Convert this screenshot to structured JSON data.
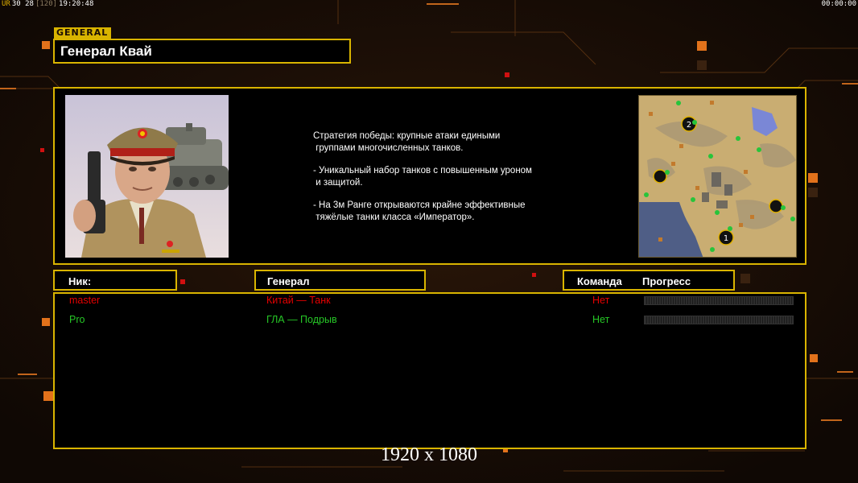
{
  "hud": {
    "left_info_a": "UR",
    "left_info_b": "30 28",
    "left_info_c": "[120]",
    "left_info_d": "19:20:48",
    "right_clock": "00:00:00"
  },
  "general": {
    "tag": "GENERAL",
    "name": "Генерал Квай"
  },
  "description": {
    "paragraphs": [
      "Стратегия победы: крупные атаки едиными\n группами многочисленных танков.",
      "- Уникальный набор танков с повышенным уроном\n и защитой.",
      "- На 3м Ранге открываются крайне эффективные\n тяжёлые танки класса «Император»."
    ]
  },
  "map": {
    "start_labels": [
      "2",
      "1"
    ]
  },
  "columns": {
    "nick": "Ник:",
    "general": "Генерал",
    "team": "Команда",
    "progress": "Прогресс"
  },
  "players": [
    {
      "nick": "master",
      "general": "Китай — Танк",
      "team": "Нет",
      "color": "#e60000"
    },
    {
      "nick": "Pro",
      "general": "ГЛА — Подрыв",
      "team": "Нет",
      "color": "#26c726"
    }
  ],
  "resolution": "1920 x 1080",
  "colors": {
    "accent": "#d9b400",
    "player_red": "#e60000",
    "player_green": "#26c726"
  }
}
